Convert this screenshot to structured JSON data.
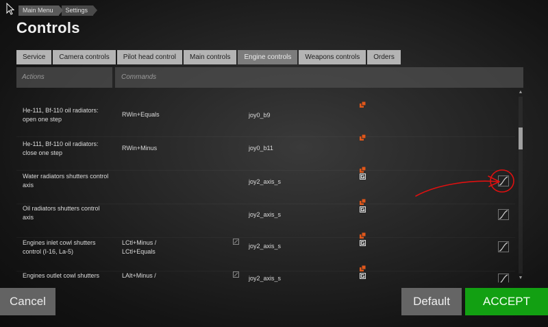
{
  "breadcrumb": [
    "Main Menu",
    "Settings"
  ],
  "page_title": "Controls",
  "tabs": [
    {
      "label": "Service",
      "active": false
    },
    {
      "label": "Camera controls",
      "active": false
    },
    {
      "label": "Pilot head control",
      "active": false
    },
    {
      "label": "Main controls",
      "active": false
    },
    {
      "label": "Engine controls",
      "active": true
    },
    {
      "label": "Weapons controls",
      "active": false
    },
    {
      "label": "Orders",
      "active": false
    }
  ],
  "columns": {
    "actions": "Actions",
    "commands": "Commands"
  },
  "rows": [
    {
      "action": "He-111, Bf-110 oil radiators: open one step",
      "cmd1": "RWin+Equals",
      "cmd2": "joy0_b9",
      "device_icons": [
        "device-icon"
      ]
    },
    {
      "action": "He-111, Bf-110 oil radiators: close one step",
      "cmd1": "RWin+Minus",
      "cmd2": "joy0_b11",
      "device_icons": [
        "device-icon"
      ]
    },
    {
      "action": "Water radiators shutters control axis",
      "cmd1": "",
      "cmd2": "joy2_axis_s",
      "device_icons": [
        "device-icon",
        "gamepad-icon"
      ],
      "curve_icon": "curve-icon"
    },
    {
      "action": "Oil radiators shutters control axis",
      "cmd1": "",
      "cmd2": "joy2_axis_s",
      "device_icons": [
        "device-icon",
        "gamepad-icon"
      ],
      "curve_icon": "curve-icon"
    },
    {
      "action": "Engines inlet cowl shutters control (I-16, La-5)",
      "cmd1": "LCtl+Minus / LCtl+Equals",
      "cmd2": "joy2_axis_s",
      "device_icons": [
        "device-icon",
        "gamepad-icon"
      ],
      "curve_icon": "curve-icon",
      "edit_icon": "edit-icon"
    },
    {
      "action": "Engines outlet cowl shutters",
      "cmd1": "LAlt+Minus /",
      "cmd2": "joy2_axis_s",
      "device_icons": [
        "device-icon",
        "gamepad-icon"
      ],
      "curve_icon": "curve-icon",
      "edit_icon": "edit-icon"
    }
  ],
  "buttons": {
    "cancel": "Cancel",
    "default": "Default",
    "accept": "ACCEPT"
  },
  "colors": {
    "accent_green": "#12a012",
    "device_orange": "#e0571a",
    "annotation_red": "#e01010"
  }
}
